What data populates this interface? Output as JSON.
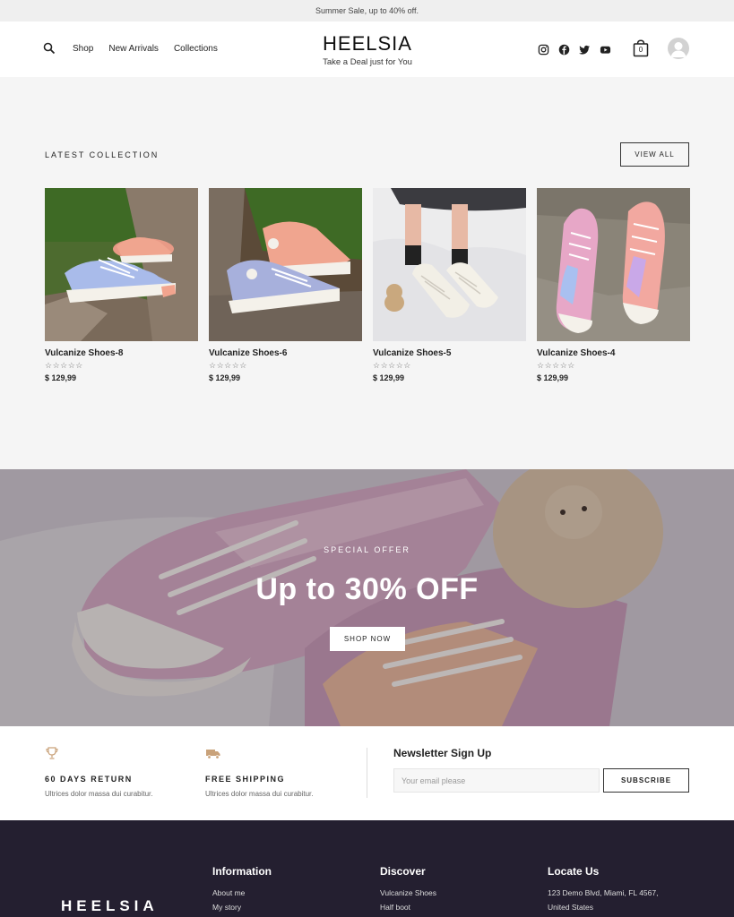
{
  "topbar": {
    "text": "Summer Sale, up to 40% off."
  },
  "header": {
    "nav": [
      "Shop",
      "New Arrivals",
      "Collections"
    ],
    "brand": "HEELSIA",
    "tagline": "Take a Deal just for You",
    "social_icons": [
      "instagram-icon",
      "facebook-icon",
      "twitter-icon",
      "youtube-icon"
    ],
    "cart_count": "0"
  },
  "collection": {
    "title": "LATEST COLLECTION",
    "view_all": "VIEW ALL",
    "products": [
      {
        "name": "Vulcanize Shoes-8",
        "price": "$ 129,99",
        "rating": 0
      },
      {
        "name": "Vulcanize Shoes-6",
        "price": "$ 129,99",
        "rating": 0
      },
      {
        "name": "Vulcanize Shoes-5",
        "price": "$ 129,99",
        "rating": 0
      },
      {
        "name": "Vulcanize Shoes-4",
        "price": "$ 129,99",
        "rating": 0
      }
    ]
  },
  "banner": {
    "eyebrow": "SPECIAL OFFER",
    "headline": "Up to 30% OFF",
    "cta": "SHOP NOW"
  },
  "features": [
    {
      "title": "60 DAYS RETURN",
      "desc": "Ultrices dolor massa dui curabitur.",
      "icon": "trophy-icon"
    },
    {
      "title": "FREE SHIPPING",
      "desc": "Ultrices dolor massa dui curabitur.",
      "icon": "truck-icon"
    }
  ],
  "newsletter": {
    "title": "Newsletter Sign Up",
    "placeholder": "Your email please",
    "button": "SUBSCRIBE"
  },
  "footer": {
    "logo": "HEELSIA",
    "columns": [
      {
        "heading": "Information",
        "links": [
          "About me",
          "My story"
        ]
      },
      {
        "heading": "Discover",
        "links": [
          "Vulcanize Shoes",
          "Half boot"
        ]
      },
      {
        "heading": "Locate Us",
        "links": [
          "123 Demo Blvd, Miami, FL 4567,",
          "United States"
        ]
      }
    ]
  },
  "colors": {
    "footer_bg": "#241f30",
    "page_bg": "#f5f5f5",
    "accent": "#222222"
  }
}
